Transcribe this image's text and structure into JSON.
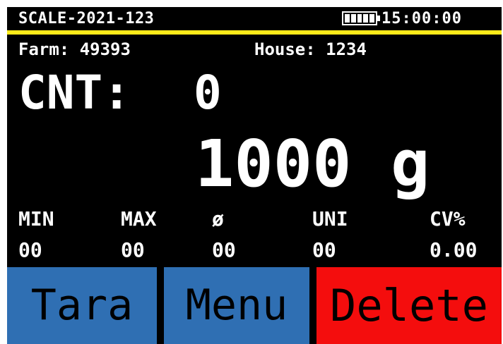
{
  "status": {
    "device_id": "SCALE-2021-123",
    "battery_icon": "battery-full-icon",
    "battery_level": 1.0,
    "time": "15:00:00"
  },
  "info": {
    "farm": "Farm: 49393",
    "house": "House: 1234"
  },
  "count": {
    "label": "CNT:",
    "value": "0"
  },
  "weight": {
    "value": "1000",
    "unit": "g"
  },
  "stats": [
    {
      "label": "MIN",
      "value": "00"
    },
    {
      "label": "MAX",
      "value": "00"
    },
    {
      "label": "ø",
      "value": "00"
    },
    {
      "label": "UNI",
      "value": "00"
    },
    {
      "label": "CV%",
      "value": "0.00"
    }
  ],
  "buttons": {
    "tara": "Tara",
    "menu": "Menu",
    "delete": "Delete"
  },
  "colors": {
    "background": "#000000",
    "accent_line": "#ffeb1a",
    "button_blue": "#2f6fb3",
    "button_red": "#f40d0d"
  }
}
